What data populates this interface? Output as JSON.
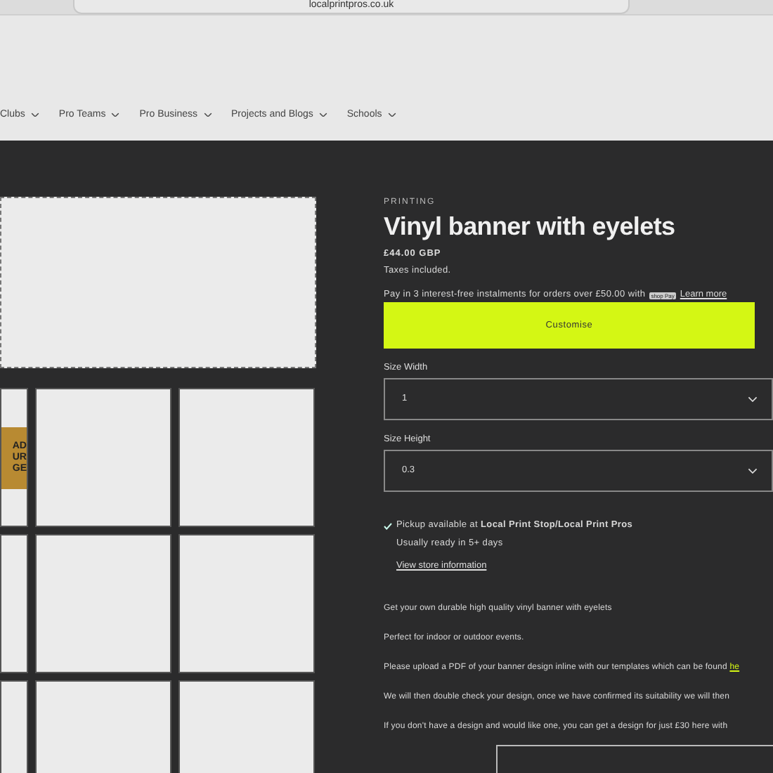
{
  "browser": {
    "url": "localprintpros.co.uk"
  },
  "nav": [
    {
      "label": "Clubs"
    },
    {
      "label": "Pro Teams"
    },
    {
      "label": "Pro Business"
    },
    {
      "label": "Projects and Blogs"
    },
    {
      "label": "Schools"
    }
  ],
  "gallery": {
    "badge_lines": [
      "AD",
      "UR",
      "GE"
    ]
  },
  "product": {
    "vendor": "PRINTING",
    "title": "Vinyl banner with eyelets",
    "price": "£44.00 GBP",
    "tax_note": "Taxes included.",
    "instalments": "Pay in 3 interest-free instalments for orders over £50.00 with",
    "shop_pay": "shop Pay",
    "learn_more": "Learn more",
    "button": "Customise",
    "options": [
      {
        "label": "Size Width",
        "value": "1"
      },
      {
        "label": "Size Height",
        "value": "0.3"
      }
    ],
    "pickup": {
      "text": "Pickup available at **Local Print Stop/Local Print Pros**",
      "ready": "Usually ready in 5+ days",
      "link": "View store information"
    },
    "description": [
      {
        "text": "Get your own durable high quality vinyl banner with eyelets"
      },
      {
        "text": "Perfect for indoor or outdoor events."
      },
      {
        "text": "Please upload a PDF of your banner design inline with our templates which can be found",
        "link": "he"
      },
      {
        "text": "We will then double check your design, once we have confirmed its suitability we will then"
      },
      {
        "text": "If you don't have a design and would like one, you can get a design for just £30 here with"
      }
    ]
  }
}
